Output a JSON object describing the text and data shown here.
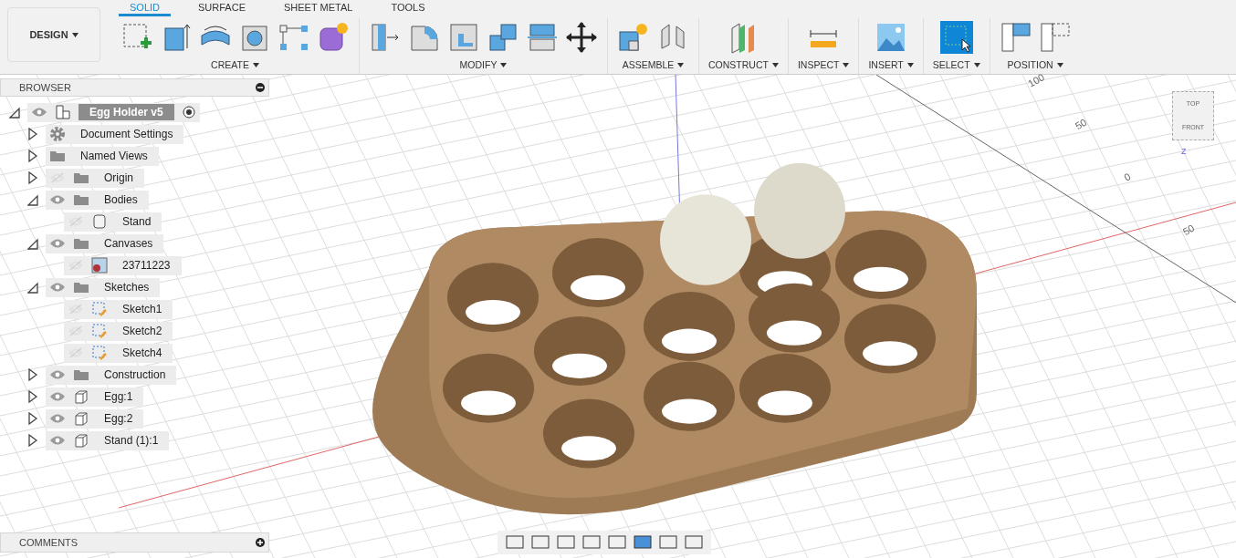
{
  "workspace_button": {
    "label": "DESIGN"
  },
  "tabs": [
    {
      "label": "SOLID",
      "selected": true
    },
    {
      "label": "SURFACE",
      "selected": false
    },
    {
      "label": "SHEET METAL",
      "selected": false
    },
    {
      "label": "TOOLS",
      "selected": false
    }
  ],
  "tool_groups": [
    {
      "label": "CREATE"
    },
    {
      "label": "MODIFY"
    },
    {
      "label": "ASSEMBLE"
    },
    {
      "label": "CONSTRUCT"
    },
    {
      "label": "INSPECT"
    },
    {
      "label": "INSERT"
    },
    {
      "label": "SELECT"
    },
    {
      "label": "POSITION"
    }
  ],
  "browser": {
    "title": "BROWSER",
    "root": {
      "label": "Egg Holder v5",
      "kind": "component",
      "visible": true,
      "expanded": true,
      "children": [
        {
          "label": "Document Settings",
          "kind": "settings",
          "expanded": false
        },
        {
          "label": "Named Views",
          "kind": "views",
          "expanded": false
        },
        {
          "label": "Origin",
          "kind": "folder",
          "visible": false,
          "expanded": false
        },
        {
          "label": "Bodies",
          "kind": "folder",
          "visible": true,
          "expanded": true,
          "children": [
            {
              "label": "Stand",
              "kind": "body",
              "visible": false
            }
          ]
        },
        {
          "label": "Canvases",
          "kind": "folder",
          "visible": true,
          "expanded": true,
          "children": [
            {
              "label": "23711223",
              "kind": "canvas",
              "visible": false
            }
          ]
        },
        {
          "label": "Sketches",
          "kind": "folder",
          "visible": true,
          "expanded": true,
          "children": [
            {
              "label": "Sketch1",
              "kind": "sketch",
              "visible": false
            },
            {
              "label": "Sketch2",
              "kind": "sketch",
              "visible": false
            },
            {
              "label": "Sketch4",
              "kind": "sketch",
              "visible": false
            }
          ]
        },
        {
          "label": "Construction",
          "kind": "folder",
          "visible": true,
          "expanded": false
        },
        {
          "label": "Egg:1",
          "kind": "occurrence",
          "visible": true,
          "expanded": false
        },
        {
          "label": "Egg:2",
          "kind": "occurrence",
          "visible": true,
          "expanded": false
        },
        {
          "label": "Stand (1):1",
          "kind": "occurrence",
          "visible": true,
          "expanded": false
        }
      ]
    }
  },
  "axis_labels": [
    "100",
    "50",
    "0",
    "50"
  ],
  "view_cube": {
    "top": "TOP",
    "front": "FRONT",
    "axis": "Z"
  },
  "comments": {
    "title": "COMMENTS"
  }
}
